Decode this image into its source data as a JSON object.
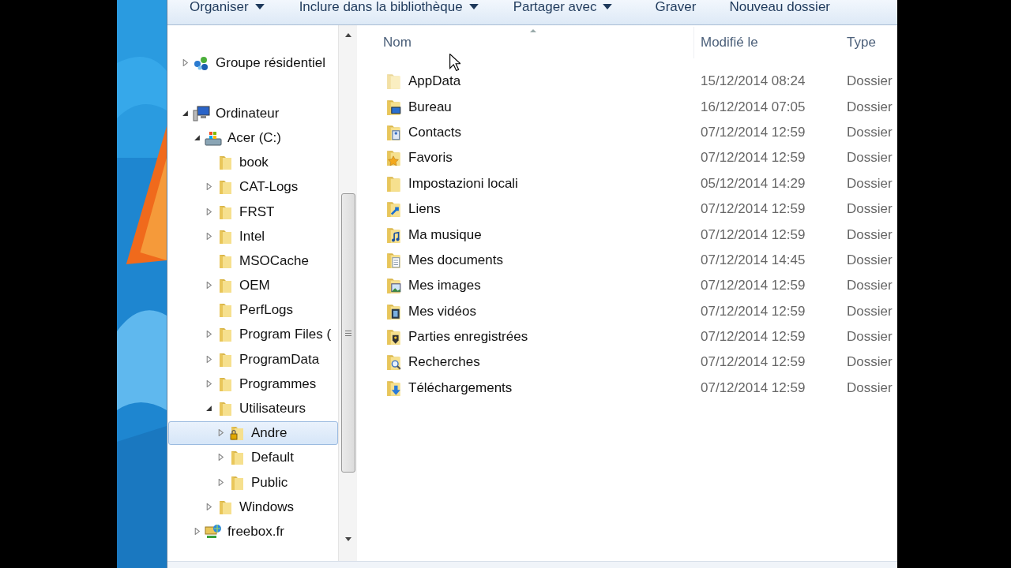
{
  "toolbar": {
    "buttons": [
      {
        "label": "Organiser",
        "dropdown": true
      },
      {
        "label": "Inclure dans la bibliothèque",
        "dropdown": true
      },
      {
        "label": "Partager avec",
        "dropdown": true
      },
      {
        "label": "Graver",
        "dropdown": false
      },
      {
        "label": "Nouveau dossier",
        "dropdown": false
      }
    ]
  },
  "navigation": {
    "items": [
      {
        "label": "Groupe résidentiel",
        "kind": "homegroup",
        "expandable": true,
        "expanded": false,
        "selected": false
      },
      {
        "label": "Ordinateur",
        "kind": "computer",
        "expandable": true,
        "expanded": true,
        "selected": false,
        "children": [
          {
            "label": "Acer (C:)",
            "kind": "drive",
            "expandable": true,
            "expanded": true,
            "selected": false,
            "children": [
              {
                "label": "book",
                "kind": "folder",
                "expandable": false,
                "selected": false
              },
              {
                "label": "CAT-Logs",
                "kind": "folder",
                "expandable": true,
                "expanded": false,
                "selected": false
              },
              {
                "label": "FRST",
                "kind": "folder",
                "expandable": true,
                "expanded": false,
                "selected": false
              },
              {
                "label": "Intel",
                "kind": "folder",
                "expandable": true,
                "expanded": false,
                "selected": false
              },
              {
                "label": "MSOCache",
                "kind": "folder",
                "expandable": false,
                "selected": false
              },
              {
                "label": "OEM",
                "kind": "folder",
                "expandable": true,
                "expanded": false,
                "selected": false
              },
              {
                "label": "PerfLogs",
                "kind": "folder",
                "expandable": false,
                "selected": false
              },
              {
                "label": "Program Files (",
                "kind": "folder",
                "expandable": true,
                "expanded": false,
                "selected": false
              },
              {
                "label": "ProgramData",
                "kind": "folder",
                "expandable": true,
                "expanded": false,
                "selected": false
              },
              {
                "label": "Programmes",
                "kind": "folder",
                "expandable": true,
                "expanded": false,
                "selected": false
              },
              {
                "label": "Utilisateurs",
                "kind": "folder",
                "expandable": true,
                "expanded": true,
                "selected": false,
                "children": [
                  {
                    "label": "Andre",
                    "kind": "user",
                    "expandable": true,
                    "expanded": false,
                    "selected": true
                  },
                  {
                    "label": "Default",
                    "kind": "folder",
                    "expandable": true,
                    "expanded": false,
                    "selected": false
                  },
                  {
                    "label": "Public",
                    "kind": "folder",
                    "expandable": true,
                    "expanded": false,
                    "selected": false
                  }
                ]
              },
              {
                "label": "Windows",
                "kind": "folder",
                "expandable": true,
                "expanded": false,
                "selected": false
              }
            ]
          },
          {
            "label": "freebox.fr",
            "kind": "netdrive",
            "expandable": true,
            "expanded": false,
            "selected": false
          }
        ]
      }
    ]
  },
  "file_list": {
    "columns": [
      "Nom",
      "Modifié le",
      "Type"
    ],
    "rows": [
      {
        "name": "AppData",
        "modified": "15/12/2014 08:24",
        "type": "Dossier",
        "kind": "hidden"
      },
      {
        "name": "Bureau",
        "modified": "16/12/2014 07:05",
        "type": "Dossier",
        "kind": "desktop"
      },
      {
        "name": "Contacts",
        "modified": "07/12/2014 12:59",
        "type": "Dossier",
        "kind": "contacts"
      },
      {
        "name": "Favoris",
        "modified": "07/12/2014 12:59",
        "type": "Dossier",
        "kind": "favorites"
      },
      {
        "name": "Impostazioni locali",
        "modified": "05/12/2014 14:29",
        "type": "Dossier",
        "kind": "plain"
      },
      {
        "name": "Liens",
        "modified": "07/12/2014 12:59",
        "type": "Dossier",
        "kind": "links"
      },
      {
        "name": "Ma musique",
        "modified": "07/12/2014 12:59",
        "type": "Dossier",
        "kind": "music"
      },
      {
        "name": "Mes documents",
        "modified": "07/12/2014 14:45",
        "type": "Dossier",
        "kind": "documents"
      },
      {
        "name": "Mes images",
        "modified": "07/12/2014 12:59",
        "type": "Dossier",
        "kind": "pictures"
      },
      {
        "name": "Mes vidéos",
        "modified": "07/12/2014 12:59",
        "type": "Dossier",
        "kind": "videos"
      },
      {
        "name": "Parties enregistrées",
        "modified": "07/12/2014 12:59",
        "type": "Dossier",
        "kind": "games"
      },
      {
        "name": "Recherches",
        "modified": "07/12/2014 12:59",
        "type": "Dossier",
        "kind": "searches"
      },
      {
        "name": "Téléchargements",
        "modified": "07/12/2014 12:59",
        "type": "Dossier",
        "kind": "downloads"
      }
    ]
  }
}
